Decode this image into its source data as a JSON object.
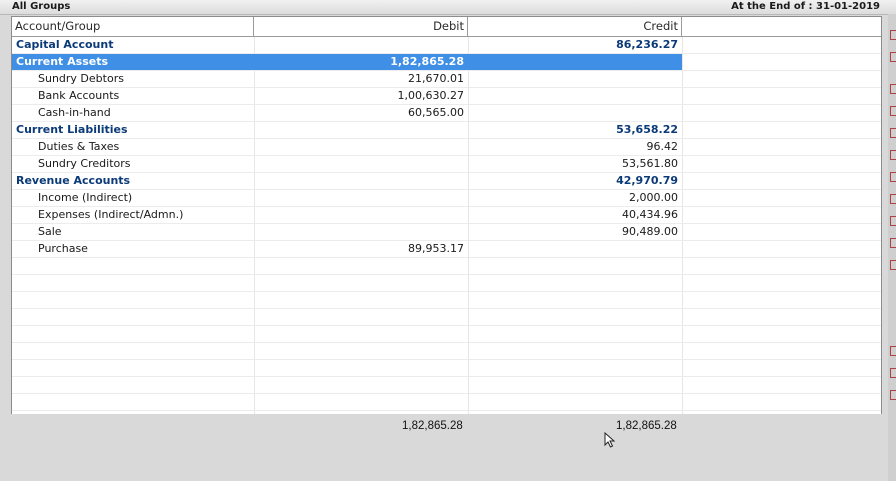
{
  "topbar": {
    "title": "All Groups",
    "period": "At the End of : 31-01-2019"
  },
  "columns": {
    "account": "Account/Group",
    "debit": "Debit",
    "credit": "Credit"
  },
  "rows": [
    {
      "name": "Capital Account",
      "debit": "",
      "credit": "86,236.27",
      "kind": "group"
    },
    {
      "name": "Current Assets",
      "debit": "1,82,865.28",
      "credit": "",
      "kind": "selected"
    },
    {
      "name": "Sundry Debtors",
      "debit": "21,670.01",
      "credit": "",
      "kind": "sub"
    },
    {
      "name": "Bank Accounts",
      "debit": "1,00,630.27",
      "credit": "",
      "kind": "sub"
    },
    {
      "name": "Cash-in-hand",
      "debit": "60,565.00",
      "credit": "",
      "kind": "sub"
    },
    {
      "name": "Current Liabilities",
      "debit": "",
      "credit": "53,658.22",
      "kind": "group"
    },
    {
      "name": "Duties & Taxes",
      "debit": "",
      "credit": "96.42",
      "kind": "sub"
    },
    {
      "name": "Sundry Creditors",
      "debit": "",
      "credit": "53,561.80",
      "kind": "sub"
    },
    {
      "name": "Revenue Accounts",
      "debit": "",
      "credit": "42,970.79",
      "kind": "group"
    },
    {
      "name": "Income (Indirect)",
      "debit": "",
      "credit": "2,000.00",
      "kind": "sub"
    },
    {
      "name": "Expenses (Indirect/Admn.)",
      "debit": "",
      "credit": "40,434.96",
      "kind": "sub"
    },
    {
      "name": "Sale",
      "debit": "",
      "credit": "90,489.00",
      "kind": "sub"
    },
    {
      "name": "Purchase",
      "debit": "89,953.17",
      "credit": "",
      "kind": "sub"
    }
  ],
  "totals": {
    "debit": "1,82,865.28",
    "credit": "1,82,865.28"
  }
}
